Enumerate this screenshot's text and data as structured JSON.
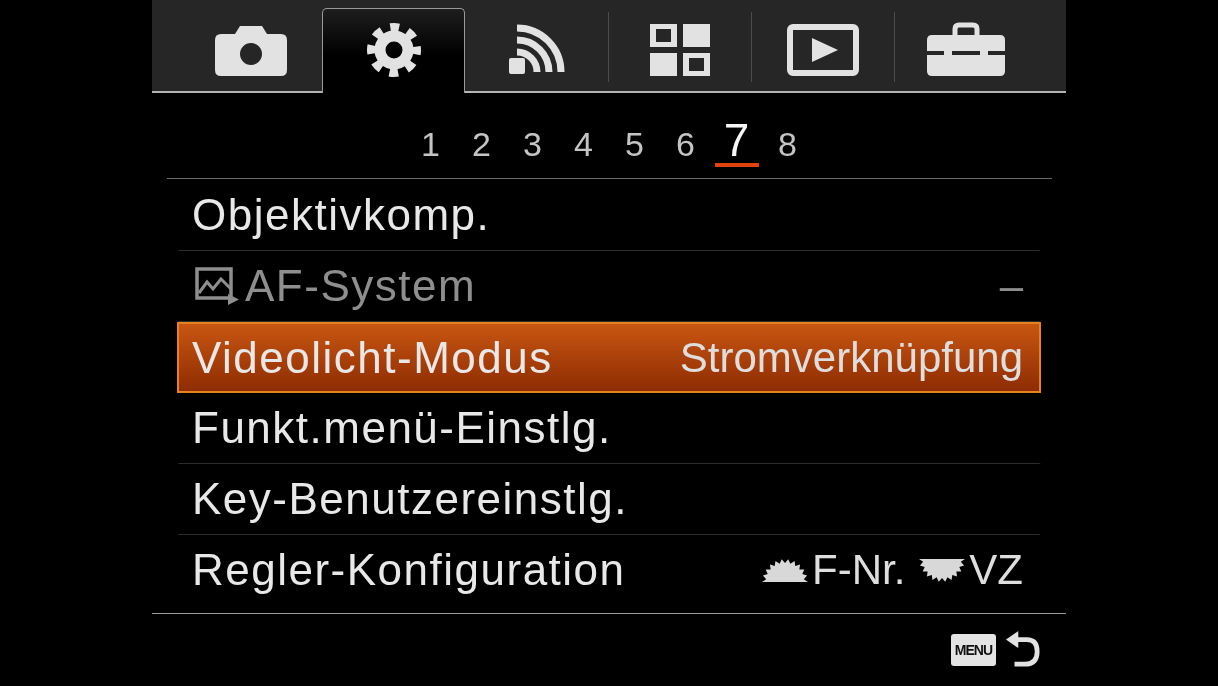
{
  "tabs": [
    {
      "kind": "camera",
      "selected": false
    },
    {
      "kind": "settings",
      "selected": true
    },
    {
      "kind": "network",
      "selected": false
    },
    {
      "kind": "applications",
      "selected": false
    },
    {
      "kind": "playback",
      "selected": false
    },
    {
      "kind": "toolbox",
      "selected": false
    }
  ],
  "pages": [
    {
      "label": "1",
      "selected": false
    },
    {
      "label": "2",
      "selected": false
    },
    {
      "label": "3",
      "selected": false
    },
    {
      "label": "4",
      "selected": false
    },
    {
      "label": "5",
      "selected": false
    },
    {
      "label": "6",
      "selected": false
    },
    {
      "label": "7",
      "selected": true
    },
    {
      "label": "8",
      "selected": false
    }
  ],
  "items": [
    {
      "label": "Objektivkomp.",
      "kind": "plain",
      "selected": false,
      "disabled": false
    },
    {
      "label": "AF-System",
      "kind": "photo-mode",
      "value": "–",
      "selected": false,
      "disabled": true
    },
    {
      "label": "Videolicht-Modus",
      "kind": "plain",
      "value": "Stromverknüpfung",
      "selected": true,
      "disabled": false
    },
    {
      "label": "Funkt.menü-Einstlg.",
      "kind": "plain",
      "selected": false,
      "disabled": false
    },
    {
      "label": "Key-Benutzereinstlg.",
      "kind": "plain",
      "selected": false,
      "disabled": false
    },
    {
      "label": "Regler-Konfiguration",
      "kind": "plain",
      "selected": false,
      "disabled": false,
      "dials": [
        {
          "kind": "front",
          "label": "F-Nr."
        },
        {
          "kind": "rear",
          "label": "VZ"
        }
      ]
    }
  ],
  "footer": {
    "menu_key": "MENU"
  }
}
